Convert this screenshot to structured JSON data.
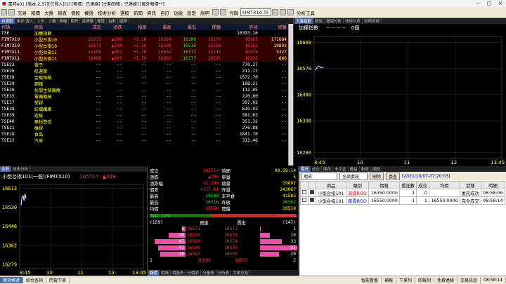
{
  "window": {
    "title": "富邦e01 [版本 2.37][已登入][1] [報價：已連線] [主動回報：已連線] [國外報價**]"
  },
  "menu": {
    "items": [
      "交易",
      "報價",
      "大盤",
      "報表",
      "個股",
      "權證",
      "技術分析",
      "選股",
      "新聞",
      "資訊",
      "自訂",
      "功能",
      "設定",
      "說明"
    ],
    "code_label": "代碼",
    "code_value": "FIMTX10.TF",
    "analysis_label": "分析工具"
  },
  "quote": {
    "tabs": [
      "自選股",
      "庫存/選入",
      "上市",
      "上櫃",
      "興櫃",
      "期貨",
      "選擇權",
      "權證",
      "指數",
      "國際"
    ],
    "headers": [
      "代碼",
      "商品",
      "成交",
      "漲跌",
      "幅度",
      "最高",
      "最低",
      "開盤",
      "昨收",
      "總量"
    ],
    "rows": [
      [
        "TSE",
        "加權指數",
        "",
        "",
        "",
        "",
        "",
        "",
        "16393.16",
        ""
      ],
      [
        "FIMTX10",
        "小型台指10",
        "16571",
        "▲209",
        "+1.28",
        "16588",
        "16200",
        "16370",
        "16362",
        "171684"
      ],
      [
        "FIMTX10",
        "小型台指10",
        "16571",
        "▲209",
        "+1.28",
        "16588",
        "16516",
        "16518",
        "16362",
        "19892"
      ],
      [
        "FIMTX11",
        "小型台指11",
        "16498",
        "▲307",
        "+1.79",
        "16552",
        "16177",
        "16335",
        "16335",
        "5327"
      ],
      [
        "FIMTX11",
        "小型台指11",
        "16498",
        "▲307",
        "+1.79",
        "16552",
        "16177",
        "16335",
        "16335",
        "886"
      ],
      [
        "TSE23",
        "電子",
        "",
        "",
        "",
        "",
        "",
        "",
        "770.27",
        ""
      ],
      [
        "TSE26",
        "航運業",
        "",
        "",
        "",
        "",
        "",
        "",
        "211.17",
        ""
      ],
      [
        "TSE28",
        "金融保險",
        "",
        "",
        "",
        "",
        "",
        "",
        "1572.70",
        ""
      ],
      [
        "TSE29",
        "鋼鐵",
        "",
        "",
        "",
        "",
        "",
        "",
        "168.21",
        ""
      ],
      [
        "TSE30",
        "化學生技醫療",
        "",
        "",
        "",
        "",
        "",
        "",
        "112.05",
        ""
      ],
      [
        "TSE35",
        "電機機械",
        "",
        "",
        "",
        "",
        "",
        "",
        "220.80",
        ""
      ],
      [
        "TSE37",
        "塑膠",
        "",
        "",
        "",
        "",
        "",
        "",
        "307.02",
        ""
      ],
      [
        "TSE38",
        "紡織纖維",
        "",
        "",
        "",
        "",
        "",
        "",
        "619.92",
        ""
      ],
      [
        "TSE39",
        "造紙",
        "",
        "",
        "",
        "",
        "",
        "",
        "381.63",
        ""
      ],
      [
        "TSE40",
        "建材營造",
        "",
        "",
        "",
        "",
        "",
        "",
        "351.32",
        ""
      ],
      [
        "TSE21",
        "橡膠",
        "",
        "",
        "",
        "",
        "",
        "",
        "276.88",
        ""
      ],
      [
        "TSE18",
        "食品",
        "",
        "",
        "",
        "",
        "",
        "",
        "1841.70",
        ""
      ],
      [
        "TSE22",
        "汽車",
        "",
        "",
        "",
        "",
        "",
        "",
        "312.46",
        ""
      ]
    ],
    "dashes": "--"
  },
  "index_panel": {
    "tabs": [
      "大盤指數",
      "報價",
      "報價分析",
      "技術分析",
      "即時新聞"
    ],
    "title": "加權指數",
    "right_label": "0個",
    "dashes": "-- -- -- --",
    "chart_data": {
      "type": "line",
      "title": "加權指數",
      "x_ticks": [
        "8:45",
        "10",
        "11",
        "12",
        "13:45"
      ],
      "y_ticks": [
        16660,
        16570,
        16480,
        16390,
        16280
      ],
      "ylim": [
        16260,
        16680
      ],
      "series": [
        {
          "values": [
            16565,
            16575,
            16578,
            16572,
            16574
          ]
        }
      ]
    }
  },
  "trend_panel": {
    "tabs": [
      "走勢",
      "技術分析"
    ],
    "title": "小型台指101(一般)(FIMTX10)",
    "price": "16571",
    "arrow": "↑",
    "change": "▲209",
    "chart_data": {
      "type": "line",
      "x_ticks": [
        "8:45",
        "10",
        "11",
        "12",
        "13:45"
      ],
      "y_ticks": [
        16613,
        16530,
        16446,
        16362,
        16279
      ],
      "ylim": [
        16260,
        16630
      ],
      "series": [
        {
          "values": [
            16540,
            16575,
            16580,
            16560,
            16588,
            16571
          ]
        }
      ]
    },
    "bottom_tabs": [
      "報價",
      "明細",
      "價量表",
      "分價表",
      "分量表",
      "分時表",
      "大單交易",
      "主力進出",
      "資訊"
    ]
  },
  "detail": {
    "rows": [
      [
        "成交",
        "16571↑",
        "時間",
        "08:58:14"
      ],
      [
        "漲跌",
        "▲209",
        "單量",
        "5"
      ],
      [
        "漲跌幅",
        "+1.28%",
        "總量",
        "19892"
      ],
      [
        "價差",
        "+177.84",
        "昨量",
        "243067"
      ],
      [
        "最高",
        "16588",
        "未平倉",
        "41583"
      ],
      [
        "最低",
        "16516",
        "昨收",
        "16362"
      ],
      [
        "均價",
        "16558",
        "開盤",
        "16518"
      ]
    ],
    "ratio_left": "內41.22%",
    "ratio_right": "外58.78%",
    "ratio_fill": 0.5878,
    "book_header": [
      "(159)",
      "買進",
      "賣出",
      "(147)"
    ],
    "book": [
      [
        "5",
        "16571",
        "16572",
        "1"
      ],
      [
        "26",
        "16570",
        "16573",
        "15"
      ],
      [
        "47",
        "16569",
        "16574",
        "33"
      ],
      [
        "42",
        "16568",
        "16575",
        "57"
      ],
      [
        "39",
        "16567",
        "16576",
        "29"
      ]
    ],
    "book_footer": [
      "1",
      "16568",
      "16572",
      "2"
    ]
  },
  "orders": {
    "tabs": [
      "委託",
      "成交",
      "庫存",
      "未平倉",
      "權益",
      "新聞",
      "選股",
      "大單",
      "新聞"
    ],
    "account": "期貨",
    "filter": "全部委託",
    "delete_btn": "刪除",
    "query_btn": "委查",
    "date": "[2021/10/07-07:20:03]",
    "headers": [
      "",
      "",
      "商品",
      "類別",
      "價格",
      "委託數",
      "成交",
      "均價",
      "狀態",
      "時間"
    ],
    "rows": [
      [
        "",
        "",
        "小型台指101",
        "買賣ROD",
        "16350.0000",
        "1",
        "0",
        "",
        "委託成功",
        "08:58:06"
      ],
      [
        "",
        "",
        "小型台指101",
        "新賣ROD",
        "16550.0000",
        "1",
        "1",
        "16550.0000",
        "完全成交",
        "08:58:14"
      ]
    ]
  },
  "status": {
    "items": [
      "期貨帳號",
      "綜合查詢",
      "閃電下單"
    ],
    "right": [
      "智能看盤",
      "補報",
      "下單列",
      "下單列",
      "回報列",
      "免費連線",
      "交易訊息"
    ],
    "time": "08:58:14"
  }
}
